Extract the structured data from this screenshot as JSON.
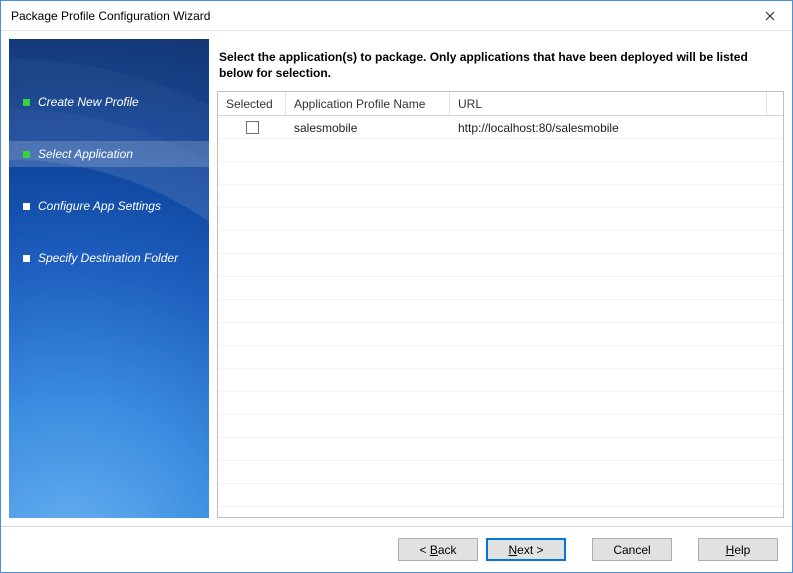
{
  "window": {
    "title": "Package Profile Configuration Wizard"
  },
  "sidebar": {
    "steps": [
      {
        "label": "Create New Profile",
        "state": "done"
      },
      {
        "label": "Select Application",
        "state": "done",
        "active": true
      },
      {
        "label": "Configure App Settings",
        "state": "pending"
      },
      {
        "label": "Specify Destination Folder",
        "state": "pending"
      }
    ]
  },
  "main": {
    "instruction": "Select the application(s) to package. Only applications that have been deployed will be listed below for selection.",
    "columns": {
      "selected": "Selected",
      "name": "Application Profile Name",
      "url": "URL"
    },
    "rows": [
      {
        "selected": false,
        "name": "salesmobile",
        "url": "http://localhost:80/salesmobile"
      }
    ]
  },
  "footer": {
    "back": "Back",
    "next": "Next >",
    "cancel": "Cancel",
    "help": "Help"
  }
}
